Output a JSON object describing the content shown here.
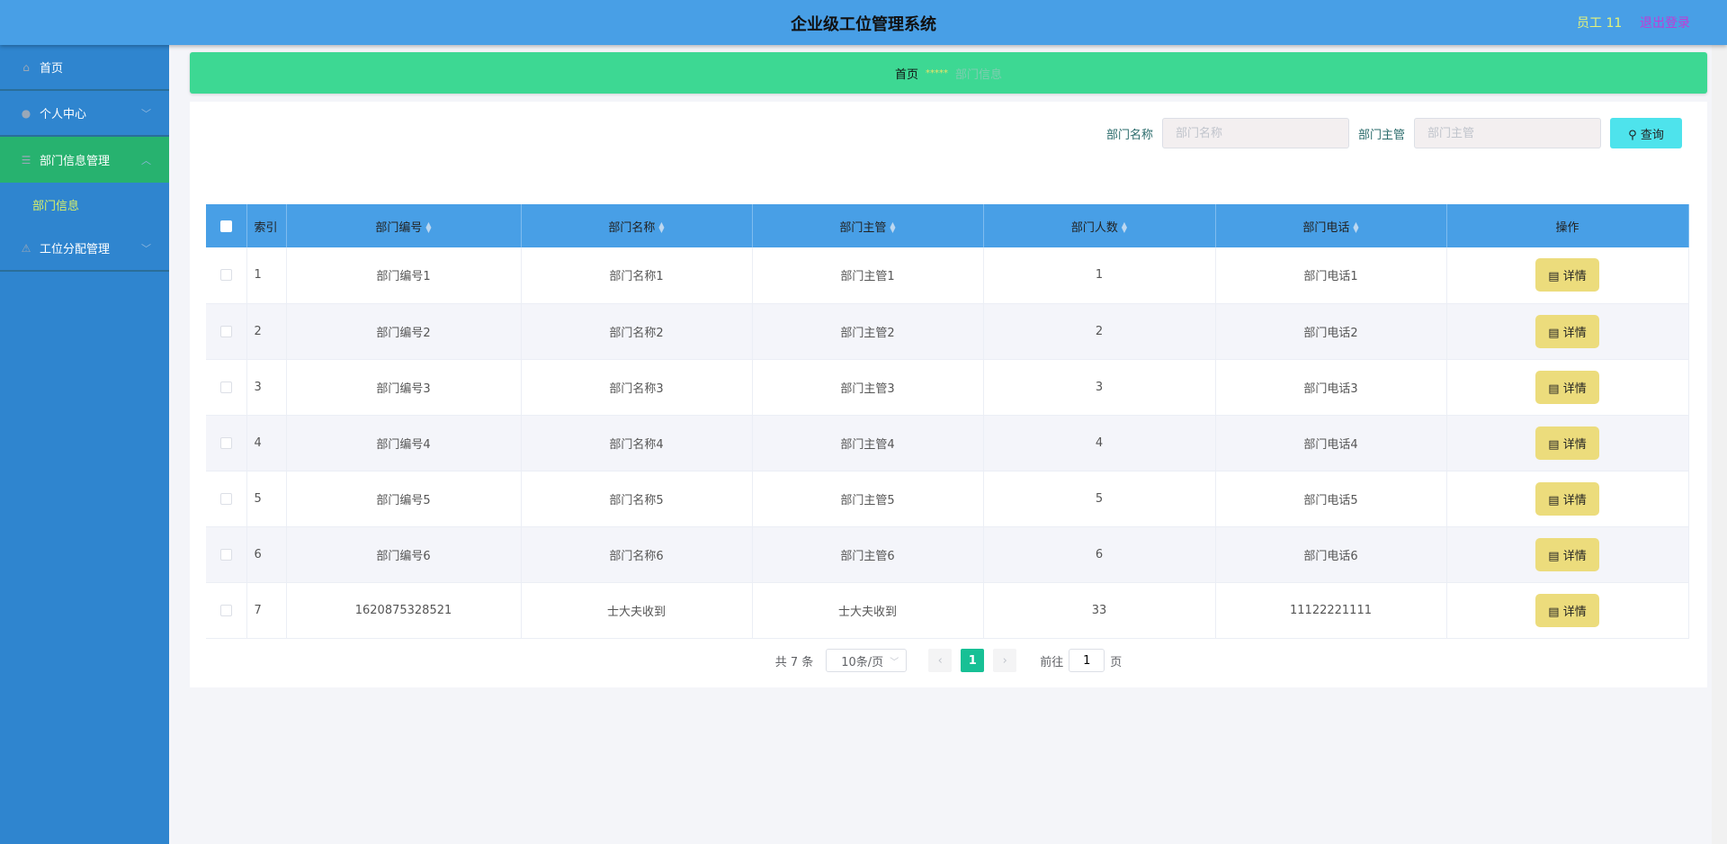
{
  "header": {
    "title": "企业级工位管理系统",
    "user": "员工 11",
    "logout": "退出登录"
  },
  "sidebar": {
    "items": [
      {
        "label": "首页",
        "icon": "home-icon"
      },
      {
        "label": "个人中心",
        "icon": "user-icon"
      },
      {
        "label": "部门信息管理",
        "icon": "menu-icon"
      },
      {
        "label": "部门信息"
      },
      {
        "label": "工位分配管理",
        "icon": "desk-icon"
      }
    ]
  },
  "breadcrumb": {
    "home": "首页",
    "separator": "*****",
    "current": "部门信息"
  },
  "search": {
    "label1": "部门名称",
    "placeholder1": "部门名称",
    "label2": "部门主管",
    "placeholder2": "部门主管",
    "button": "查询"
  },
  "table": {
    "headers": [
      "索引",
      "部门编号",
      "部门名称",
      "部门主管",
      "部门人数",
      "部门电话",
      "操作"
    ],
    "action": "详情",
    "rows": [
      [
        "1",
        "部门编号1",
        "部门名称1",
        "部门主管1",
        "1",
        "部门电话1"
      ],
      [
        "2",
        "部门编号2",
        "部门名称2",
        "部门主管2",
        "2",
        "部门电话2"
      ],
      [
        "3",
        "部门编号3",
        "部门名称3",
        "部门主管3",
        "3",
        "部门电话3"
      ],
      [
        "4",
        "部门编号4",
        "部门名称4",
        "部门主管4",
        "4",
        "部门电话4"
      ],
      [
        "5",
        "部门编号5",
        "部门名称5",
        "部门主管5",
        "5",
        "部门电话5"
      ],
      [
        "6",
        "部门编号6",
        "部门名称6",
        "部门主管6",
        "6",
        "部门电话6"
      ],
      [
        "7",
        "1620875328521",
        "士大夫收到",
        "士大夫收到",
        "33",
        "11122221111"
      ]
    ]
  },
  "pagination": {
    "total": "共 7 条",
    "page_size": "10条/页",
    "current": "1",
    "goto_label": "前往",
    "goto_value": "1",
    "page_suffix": "页"
  },
  "colors": {
    "header": "#489fe6",
    "sidebar": "#2f85cf",
    "active": "#27b26f",
    "breadcrumb": "#3dd893",
    "detail": "#ecdc7c"
  }
}
